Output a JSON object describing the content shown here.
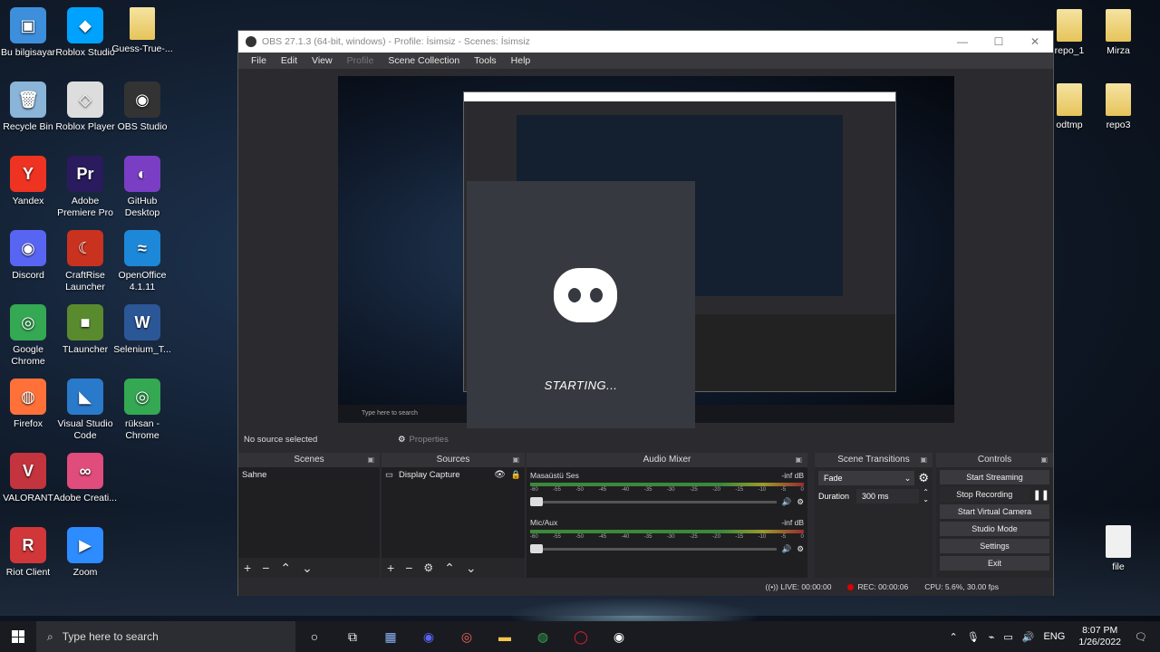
{
  "desktop": {
    "icons_col1": [
      {
        "label": "Bu bilgisayar",
        "glyph": "▣",
        "color": "#3d8fdc"
      },
      {
        "label": "Recycle Bin",
        "glyph": "🗑",
        "color": "#8ab4d8"
      },
      {
        "label": "Yandex",
        "glyph": "Y",
        "color": "#e32"
      },
      {
        "label": "Discord",
        "glyph": "◉",
        "color": "#5865f2"
      },
      {
        "label": "Google Chrome",
        "glyph": "◎",
        "color": "#34a853"
      },
      {
        "label": "Firefox",
        "glyph": "◍",
        "color": "#ff7139"
      },
      {
        "label": "VALORANT",
        "glyph": "V",
        "color": "#c4343e"
      },
      {
        "label": "Riot Client",
        "glyph": "R",
        "color": "#d13639"
      }
    ],
    "icons_col2": [
      {
        "label": "Roblox Studio",
        "glyph": "◆",
        "color": "#00a2ff"
      },
      {
        "label": "Roblox Player",
        "glyph": "◇",
        "color": "#ddd"
      },
      {
        "label": "Adobe Premiere Pro",
        "glyph": "Pr",
        "color": "#2a1b5e"
      },
      {
        "label": "CraftRise Launcher",
        "glyph": "☾",
        "color": "#c8321e"
      },
      {
        "label": "TLauncher",
        "glyph": "■",
        "color": "#5a8a2e"
      },
      {
        "label": "Visual Studio Code",
        "glyph": "◣",
        "color": "#2a7acb"
      },
      {
        "label": "Adobe Creati...",
        "glyph": "∞",
        "color": "#e04c7c"
      },
      {
        "label": "Zoom",
        "glyph": "▶",
        "color": "#2d8cff"
      }
    ],
    "icons_col3": [
      {
        "label": "Guess-True-...",
        "glyph": "",
        "color": "#e8c35a"
      },
      {
        "label": "OBS Studio",
        "glyph": "◉",
        "color": "#333"
      },
      {
        "label": "GitHub Desktop",
        "glyph": "◐",
        "color": "#7a3ec4"
      },
      {
        "label": "OpenOffice 4.1.11",
        "glyph": "≈",
        "color": "#1e88d8"
      },
      {
        "label": "Selenium_T...",
        "glyph": "W",
        "color": "#2b5797"
      },
      {
        "label": "rüksan - Chrome",
        "glyph": "◎",
        "color": "#34a853"
      }
    ],
    "right_folders": [
      {
        "label": "repo_1"
      },
      {
        "label": "Mirza"
      },
      {
        "label": "odtmp"
      },
      {
        "label": "repo3"
      },
      {
        "label": "file"
      }
    ]
  },
  "obs": {
    "title": "OBS 27.1.3 (64-bit, windows) - Profile: İsimsiz - Scenes: İsimsiz",
    "menu": [
      "File",
      "Edit",
      "View",
      "Profile",
      "Scene Collection",
      "Tools",
      "Help"
    ],
    "splash_text": "STARTING...",
    "no_source": "No source selected",
    "properties": "Properties",
    "scenes": {
      "title": "Scenes",
      "items": [
        "Sahne"
      ]
    },
    "sources": {
      "title": "Sources",
      "items": [
        "Display Capture"
      ]
    },
    "mixer": {
      "title": "Audio Mixer",
      "channels": [
        {
          "name": "Masaüstü Ses",
          "level": "-inf dB"
        },
        {
          "name": "Mic/Aux",
          "level": "-inf dB"
        }
      ],
      "ticks": [
        "-60",
        "-55",
        "-50",
        "-45",
        "-40",
        "-35",
        "-30",
        "-25",
        "-20",
        "-15",
        "-10",
        "-5",
        "0"
      ]
    },
    "transitions": {
      "title": "Scene Transitions",
      "selected": "Fade",
      "duration_label": "Duration",
      "duration_value": "300 ms"
    },
    "controls": {
      "title": "Controls",
      "start_streaming": "Start Streaming",
      "stop_recording": "Stop Recording",
      "start_virtual_camera": "Start Virtual Camera",
      "studio_mode": "Studio Mode",
      "settings": "Settings",
      "exit": "Exit"
    },
    "status": {
      "live": "LIVE: 00:00:00",
      "rec": "REC: 00:00:06",
      "cpu": "CPU: 5.6%, 30.00 fps"
    }
  },
  "taskbar": {
    "search_placeholder": "Type here to search",
    "lang": "ENG",
    "time": "8:07 PM",
    "date": "1/26/2022"
  }
}
